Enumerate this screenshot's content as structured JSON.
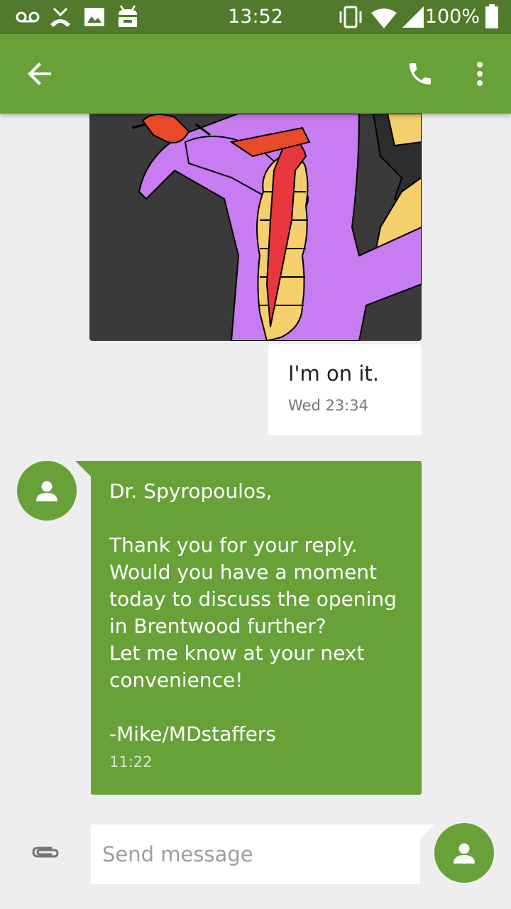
{
  "status_bar": {
    "time": "13:52",
    "battery_pct": "100%",
    "icons": [
      "voicemail-icon",
      "missed-call-icon",
      "image-icon",
      "android-icon",
      "vibrate-icon",
      "wifi-icon",
      "signal-icon",
      "battery-icon"
    ]
  },
  "app_bar": {
    "icons": [
      "back-arrow-icon",
      "phone-icon",
      "more-vert-icon"
    ],
    "color": "#67a138"
  },
  "messages": [
    {
      "direction": "outgoing",
      "type": "image",
      "image_description": "cartoon purple dragon with red tie"
    },
    {
      "direction": "outgoing",
      "text": "I'm on it.",
      "time": "Wed 23:34"
    },
    {
      "direction": "incoming",
      "text": "Dr. Spyropoulos,\n\nThank you for your reply.\nWould you have a moment today to discuss the opening in Brentwood further?\nLet me know at your next convenience!\n\n-Mike/MDstaffers",
      "time": "11:22"
    }
  ],
  "composer": {
    "placeholder": "Send message",
    "value": ""
  },
  "colors": {
    "accent": "#67a138",
    "status_bar": "#517a2c",
    "background": "#eeeeee"
  }
}
